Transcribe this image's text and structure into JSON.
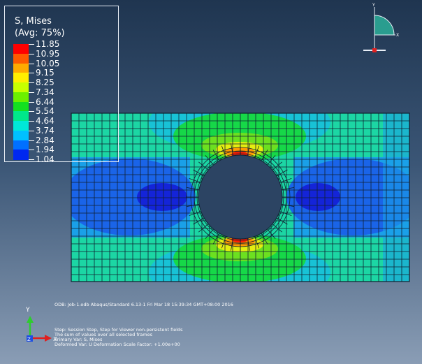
{
  "legend": {
    "title_line1": "S, Mises",
    "title_line2": "(Avg: 75%)",
    "values": [
      "11.85",
      "10.95",
      "10.05",
      "9.15",
      "8.25",
      "7.34",
      "6.44",
      "5.54",
      "4.64",
      "3.74",
      "2.84",
      "1.94",
      "1.04"
    ],
    "band_colors": [
      "#ff0000",
      "#ff5a00",
      "#ffaa00",
      "#ffee00",
      "#c8ff00",
      "#6cf000",
      "#14e020",
      "#00e88a",
      "#00e8d8",
      "#00c0ff",
      "#0070ff",
      "#0028f0"
    ]
  },
  "mesh": {
    "colors": {
      "hot": "#ff1a00",
      "orange": "#ff9a00",
      "yellow": "#e4ee10",
      "light_green": "#6ce020",
      "green": "#16d848",
      "teal": "#1cd6a4",
      "cyan": "#18c2d6",
      "light_blue": "#1aa0e8",
      "blue": "#1a64e8",
      "dark_blue": "#1424d8",
      "grid": "#102030"
    }
  },
  "triad": {
    "y_label": "Y",
    "x_label": "X"
  },
  "axis_icon": {
    "y_label": "Y",
    "x_label": "X",
    "z_label": "Z",
    "y_color": "#2ecc2e",
    "x_color": "#e02020",
    "z_color": "#2050e0"
  },
  "info": {
    "odb_line": "ODB: Job-1.odb    Abaqus/Standard 6.13-1    Fri Mar 18 15:39:34 GMT+08:00 2016",
    "step_line": "Step: Session Step, Step for Viewer non-persistent fields",
    "values_line": "The sum of values over all selected frames",
    "primary_var": "Primary Var: S, Mises",
    "deformed_var": "Deformed Var: U   Deformation Scale Factor: +1.00e+00"
  }
}
